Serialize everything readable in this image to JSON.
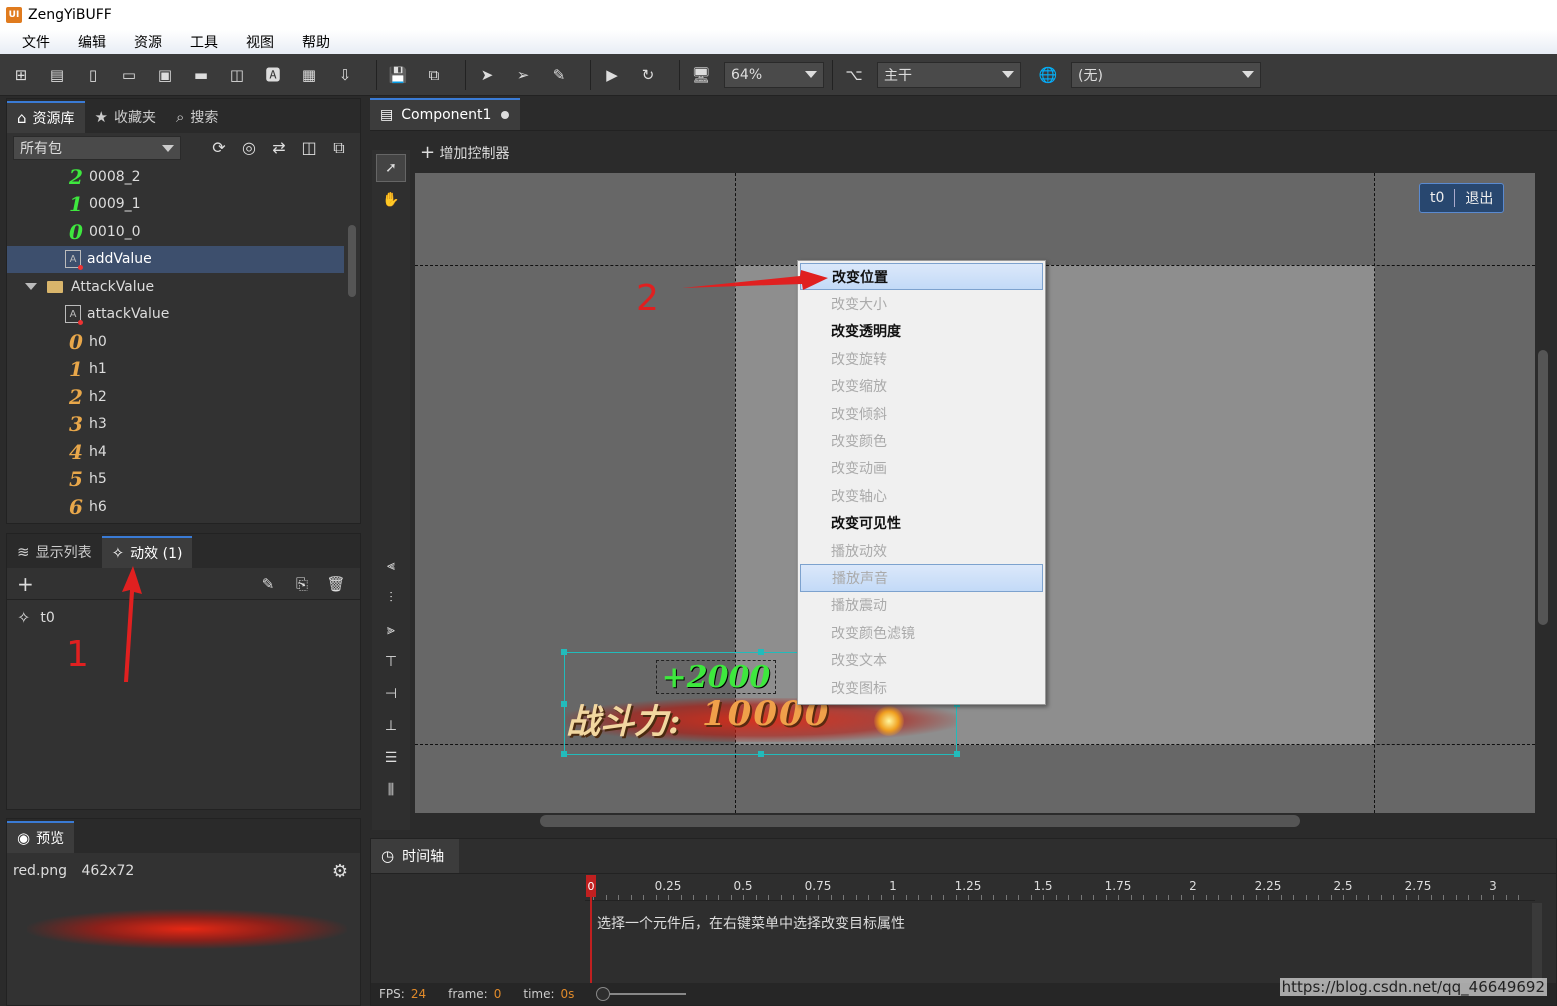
{
  "app": {
    "title": "ZengYiBUFF",
    "logo": "UI"
  },
  "menu": [
    "文件",
    "编辑",
    "资源",
    "工具",
    "视图",
    "帮助"
  ],
  "toolbar": {
    "zoom": "64%",
    "branch": "主干",
    "language": "(无)"
  },
  "library": {
    "tabs": [
      {
        "label": "资源库",
        "icon": "home-icon"
      },
      {
        "label": "收藏夹",
        "icon": "star-icon"
      },
      {
        "label": "搜索",
        "icon": "search-icon"
      }
    ],
    "package_select": "所有包",
    "items": [
      {
        "glyph": "2",
        "glyph_color": "green",
        "label": "0008_2",
        "indent": 1
      },
      {
        "glyph": "1",
        "glyph_color": "green",
        "label": "0009_1",
        "indent": 1
      },
      {
        "glyph": "0",
        "glyph_color": "green",
        "label": "0010_0",
        "indent": 1
      },
      {
        "glyph": "A",
        "type": "file",
        "label": "addValue",
        "indent": 1,
        "selected": true
      },
      {
        "type": "folder",
        "label": "AttackValue",
        "indent": 0,
        "expanded": true
      },
      {
        "glyph": "A",
        "type": "file",
        "label": "attackValue",
        "indent": 1
      },
      {
        "glyph": "0",
        "glyph_color": "gold",
        "label": "h0",
        "indent": 1
      },
      {
        "glyph": "1",
        "glyph_color": "gold",
        "label": "h1",
        "indent": 1
      },
      {
        "glyph": "2",
        "glyph_color": "gold",
        "label": "h2",
        "indent": 1
      },
      {
        "glyph": "3",
        "glyph_color": "gold",
        "label": "h3",
        "indent": 1
      },
      {
        "glyph": "4",
        "glyph_color": "gold",
        "label": "h4",
        "indent": 1
      },
      {
        "glyph": "5",
        "glyph_color": "gold",
        "label": "h5",
        "indent": 1
      },
      {
        "glyph": "6",
        "glyph_color": "gold",
        "label": "h6",
        "indent": 1
      }
    ]
  },
  "effects_panel": {
    "tabs": [
      {
        "label": "显示列表",
        "icon": "layers-icon"
      },
      {
        "label": "动效 (1)",
        "icon": "effect-icon"
      }
    ],
    "items": [
      {
        "label": "t0"
      }
    ]
  },
  "preview": {
    "tab": "预览",
    "file": "red.png",
    "size": "462x72"
  },
  "document": {
    "tab": "Component1",
    "add_controller": "增加控制器",
    "exit_group": {
      "name": "t0",
      "exit": "退出"
    }
  },
  "stage": {
    "plus_value": "+2000",
    "power_label": "战斗力:",
    "power_value": "10000"
  },
  "context_menu": [
    {
      "label": "改变位置",
      "enabled": true,
      "highlight": true
    },
    {
      "label": "改变大小",
      "enabled": false
    },
    {
      "label": "改变透明度",
      "enabled": true
    },
    {
      "label": "改变旋转",
      "enabled": false
    },
    {
      "label": "改变缩放",
      "enabled": false
    },
    {
      "label": "改变倾斜",
      "enabled": false
    },
    {
      "label": "改变颜色",
      "enabled": false
    },
    {
      "label": "改变动画",
      "enabled": false
    },
    {
      "label": "改变轴心",
      "enabled": false
    },
    {
      "label": "改变可见性",
      "enabled": true
    },
    {
      "label": "播放动效",
      "enabled": false
    },
    {
      "label": "播放声音",
      "enabled": false,
      "highlight": true
    },
    {
      "label": "播放震动",
      "enabled": false
    },
    {
      "label": "改变颜色滤镜",
      "enabled": false
    },
    {
      "label": "改变文本",
      "enabled": false
    },
    {
      "label": "改变图标",
      "enabled": false
    }
  ],
  "annotations": {
    "one": "1",
    "two": "2"
  },
  "timeline": {
    "tab": "时间轴",
    "playhead": "0",
    "ruler": [
      "0.25",
      "0.5",
      "0.75",
      "1",
      "1.25",
      "1.5",
      "1.75",
      "2",
      "2.25",
      "2.5",
      "2.75",
      "3"
    ],
    "hint": "选择一个元件后，在右键菜单中选择改变目标属性",
    "fps_label": "FPS:",
    "fps": "24",
    "frame_label": "frame:",
    "frame": "0",
    "time_label": "time:",
    "time": "0s"
  },
  "watermark": "https://blog.csdn.net/qq_46649692",
  "colors": {
    "accent": "#3a7bd5",
    "annotation": "#e02020",
    "selection": "#3d4f6d"
  }
}
